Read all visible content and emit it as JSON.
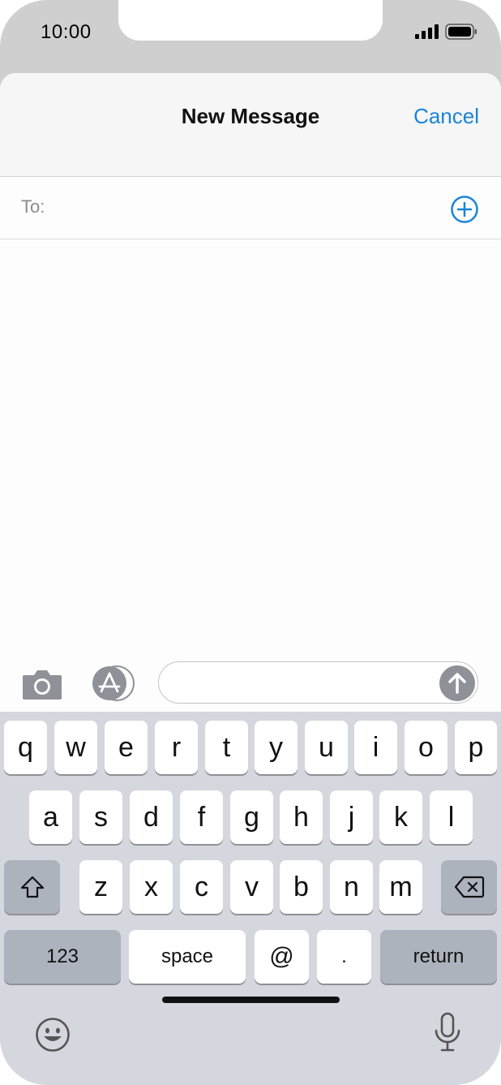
{
  "status_bar": {
    "time": "10:00"
  },
  "nav": {
    "title": "New Message",
    "cancel_label": "Cancel"
  },
  "recipient": {
    "label": "To:"
  },
  "compose": {
    "placeholder": ""
  },
  "keyboard": {
    "row1": [
      "q",
      "w",
      "e",
      "r",
      "t",
      "y",
      "u",
      "i",
      "o",
      "p"
    ],
    "row2": [
      "a",
      "s",
      "d",
      "f",
      "g",
      "h",
      "j",
      "k",
      "l"
    ],
    "row3": [
      "z",
      "x",
      "c",
      "v",
      "b",
      "n",
      "m"
    ],
    "numbers_label": "123",
    "space_label": "space",
    "at_label": "@",
    "dot_label": ".",
    "return_label": "return"
  },
  "icons": {
    "signal": "cellular-signal-icon",
    "battery": "battery-icon",
    "add_contact": "add-contact-icon",
    "camera": "camera-icon",
    "app_store": "app-store-icon",
    "send": "send-arrow-icon",
    "shift": "shift-icon",
    "backspace": "backspace-icon",
    "emoji": "emoji-icon",
    "microphone": "microphone-icon"
  },
  "colors": {
    "accent": "#1a84d8",
    "keyboard_bg": "#d4d7dd",
    "key_dark": "#adb3bd",
    "send_button": "#8e9198"
  }
}
